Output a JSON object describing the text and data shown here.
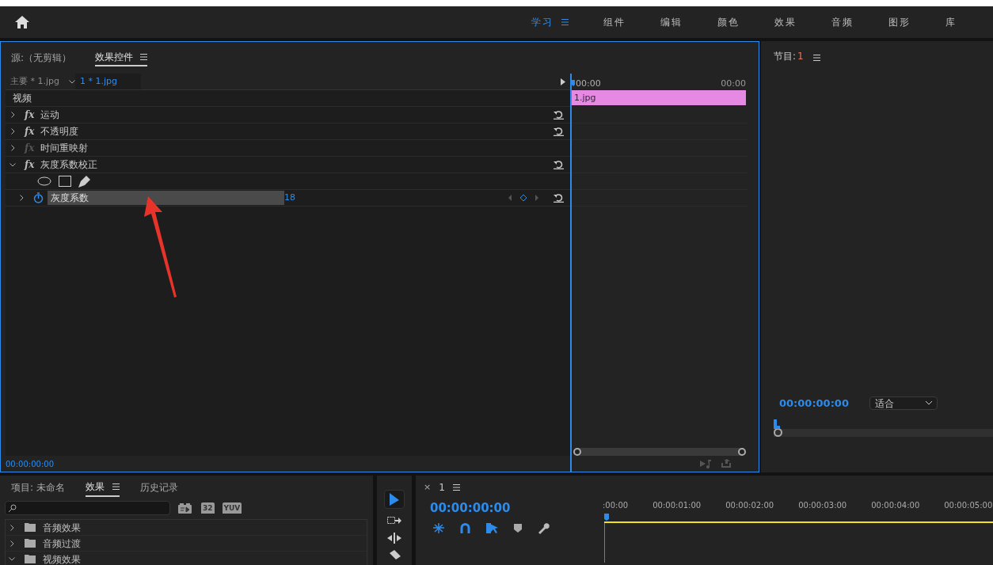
{
  "workspaces": [
    {
      "label": "学习",
      "selected": true
    },
    {
      "label": "组件",
      "selected": false
    },
    {
      "label": "编辑",
      "selected": false
    },
    {
      "label": "颜色",
      "selected": false
    },
    {
      "label": "效果",
      "selected": false
    },
    {
      "label": "音频",
      "selected": false
    },
    {
      "label": "图形",
      "selected": false
    },
    {
      "label": "库",
      "selected": false
    }
  ],
  "effect_controls": {
    "tabs": [
      {
        "label": "源:（无剪辑）",
        "selected": false
      },
      {
        "label": "效果控件",
        "selected": true
      }
    ],
    "clip_tabs": [
      {
        "label": "主要 * 1.jpg",
        "selected": false
      },
      {
        "label": "1 * 1.jpg",
        "selected": true
      }
    ],
    "section": "视频",
    "effects": [
      {
        "name": "运动",
        "fx": "fx",
        "expanded": false,
        "enabled": true,
        "resettable": true
      },
      {
        "name": "不透明度",
        "fx": "fx",
        "expanded": false,
        "enabled": true,
        "resettable": true
      },
      {
        "name": "时间重映射",
        "fx": "fx",
        "expanded": false,
        "enabled": false,
        "resettable": false
      },
      {
        "name": "灰度系数校正",
        "fx": "fx",
        "expanded": true,
        "enabled": true,
        "resettable": true,
        "params": [
          {
            "name": "灰度系数",
            "value": "18",
            "selected": true
          }
        ]
      }
    ],
    "ruler": [
      "00:00",
      "00:00"
    ],
    "clip": "1.jpg",
    "timecode": "00:00:00:00"
  },
  "program": {
    "title": "节目:",
    "sequence": "1",
    "timecode": "00:00:00:00",
    "zoom": "适合"
  },
  "project_panel": {
    "tabs": [
      {
        "label": "项目: 未命名",
        "selected": false
      },
      {
        "label": "效果",
        "selected": true
      },
      {
        "label": "历史记录",
        "selected": false
      }
    ],
    "badges": [
      "32",
      "YUV"
    ],
    "tree": [
      {
        "label": "音频效果",
        "expanded": false
      },
      {
        "label": "音频过渡",
        "expanded": false
      },
      {
        "label": "视频效果",
        "expanded": true
      }
    ]
  },
  "timeline": {
    "tab": "1",
    "close": "×",
    "timecode": "00:00:00:00",
    "ruler": [
      ":00:00",
      "00:00:01:00",
      "00:00:02:00",
      "00:00:03:00",
      "00:00:04:00",
      "00:00:05:00"
    ]
  }
}
